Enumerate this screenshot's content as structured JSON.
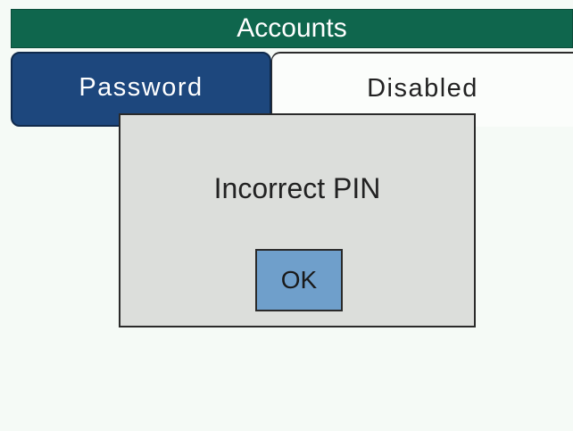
{
  "header": {
    "title": "Accounts"
  },
  "tabs": [
    {
      "label": "Password",
      "selected": true
    },
    {
      "label": "Disabled",
      "selected": false
    }
  ],
  "dialog": {
    "message": "Incorrect PIN",
    "ok_label": "OK"
  },
  "colors": {
    "title_bar": "#0f664d",
    "tab_selected": "#1d477d",
    "tab_unselected": "#fbfdfb",
    "background": "#f5faf6",
    "dialog_background": "#dcdedb",
    "ok_button": "#6f9fcb"
  }
}
